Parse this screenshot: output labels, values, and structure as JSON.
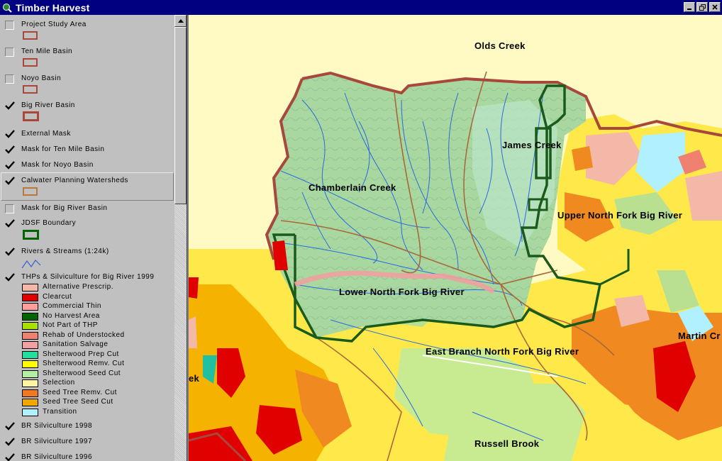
{
  "window": {
    "title": "Timber Harvest",
    "icons": {
      "app": "magnifier-globe-icon",
      "minimize": "minimize-icon",
      "restore": "restore-icon",
      "close": "close-icon"
    }
  },
  "legend": {
    "layers": [
      {
        "name": "Project Study Area",
        "checked": false,
        "symbol": "outline",
        "color": "#a84838"
      },
      {
        "name": "Ten Mile Basin",
        "checked": false,
        "symbol": "outline",
        "color": "#a84838"
      },
      {
        "name": "Noyo Basin",
        "checked": false,
        "symbol": "outline",
        "color": "#a84838"
      },
      {
        "name": "Big River Basin",
        "checked": true,
        "symbol": "outline",
        "color": "#a84838"
      },
      {
        "name": "External Mask",
        "checked": true
      },
      {
        "name": "Mask for Ten Mile Basin",
        "checked": true
      },
      {
        "name": "Mask for Noyo Basin",
        "checked": true
      },
      {
        "name": "Calwater Planning Watersheds",
        "checked": true,
        "symbol": "outline",
        "color": "#b87838"
      },
      {
        "name": "Mask for Big River Basin",
        "checked": false
      },
      {
        "name": "JDSF Boundary",
        "checked": true,
        "symbol": "outline",
        "color": "#006400"
      },
      {
        "name": "Rivers & Streams (1:24k)",
        "checked": true,
        "symbol": "line",
        "color": "#3060d0"
      },
      {
        "name": "THPs & Silviculture for Big River 1999",
        "checked": true,
        "symbol": "classes"
      },
      {
        "name": "BR Silviculture 1998",
        "checked": true
      },
      {
        "name": "BR Silviculture 1997",
        "checked": true
      },
      {
        "name": "BR Silviculture 1996",
        "checked": true
      }
    ],
    "thp_classes": [
      {
        "label": "Alternative Prescrip.",
        "color": "#f4b8a8"
      },
      {
        "label": "Clearcut",
        "color": "#e00000"
      },
      {
        "label": "Commercial Thin",
        "color": "#ff9c9c"
      },
      {
        "label": "No Harvest Area",
        "color": "#006400"
      },
      {
        "label": "Not Part of THP",
        "color": "#a8e000"
      },
      {
        "label": "Rehab of Understocked",
        "color": "#f08070"
      },
      {
        "label": "Sanitation Salvage",
        "color": "#f4a0a0"
      },
      {
        "label": "Shelterwood Prep Cut",
        "color": "#20e0a0"
      },
      {
        "label": "Shelterwood Remv. Cut",
        "color": "#ffff00"
      },
      {
        "label": "Shelterwood Seed Cut",
        "color": "#b0f0a0"
      },
      {
        "label": "Selection",
        "color": "#fff4a0"
      },
      {
        "label": "Seed Tree Remv. Cut",
        "color": "#f07820"
      },
      {
        "label": "Seed Tree Seed Cut",
        "color": "#f0a800"
      },
      {
        "label": "Transition",
        "color": "#b0f0ff"
      }
    ]
  },
  "map": {
    "labels": [
      "Olds Creek",
      "James Creek",
      "Chamberlain Creek",
      "Upper North Fork Big River",
      "Lower North Fork Big River",
      "Martin Cr",
      "East Branch North Fork Big River",
      "ek",
      "Russell Brook"
    ]
  }
}
